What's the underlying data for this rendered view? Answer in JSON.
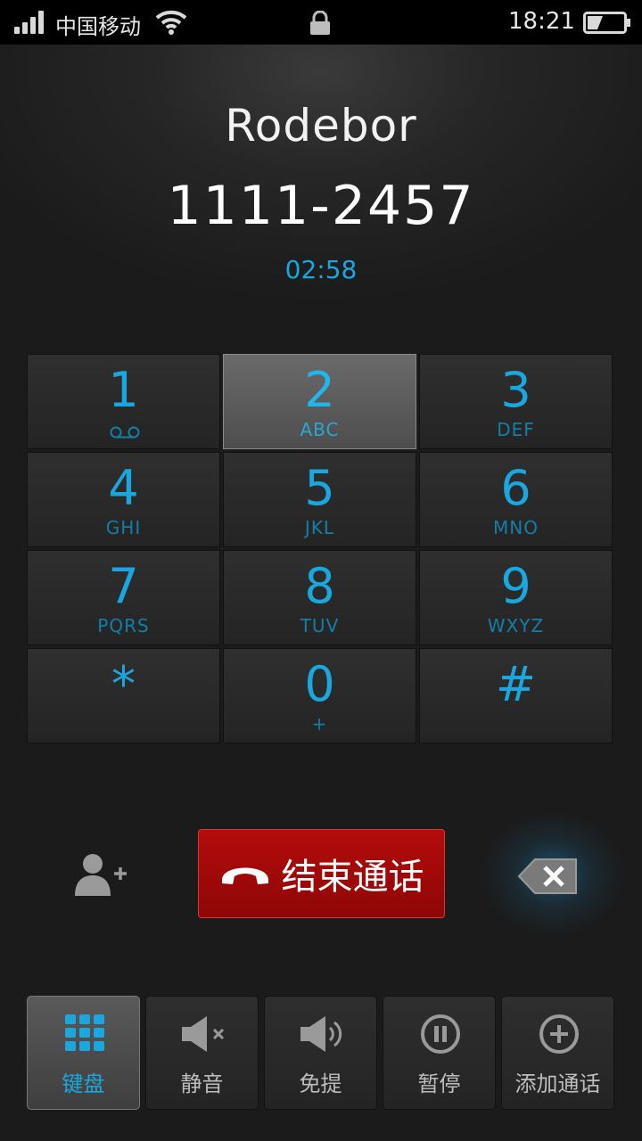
{
  "status_bar": {
    "carrier": "中国移动",
    "time": "18:21",
    "icons": [
      "signal-icon",
      "wifi-icon",
      "lock-icon",
      "battery-icon"
    ]
  },
  "call": {
    "name": "Rodebor",
    "number": "1111-2457",
    "duration": "02:58"
  },
  "dialpad": {
    "keys": [
      {
        "digit": "1",
        "letters": "",
        "icon": "voicemail-icon"
      },
      {
        "digit": "2",
        "letters": "ABC",
        "pressed": true
      },
      {
        "digit": "3",
        "letters": "DEF"
      },
      {
        "digit": "4",
        "letters": "GHI"
      },
      {
        "digit": "5",
        "letters": "JKL"
      },
      {
        "digit": "6",
        "letters": "MNO"
      },
      {
        "digit": "7",
        "letters": "PQRS"
      },
      {
        "digit": "8",
        "letters": "TUV"
      },
      {
        "digit": "9",
        "letters": "WXYZ"
      },
      {
        "digit": "*",
        "letters": ""
      },
      {
        "digit": "0",
        "letters": "+"
      },
      {
        "digit": "#",
        "letters": ""
      }
    ]
  },
  "controls": {
    "end_call_label": "结束通话",
    "add_contact_icon": "add-contact-icon",
    "backspace_icon": "backspace-icon"
  },
  "toolbar": {
    "items": [
      {
        "label": "键盘",
        "icon": "keypad-icon",
        "active": true
      },
      {
        "label": "静音",
        "icon": "mute-icon"
      },
      {
        "label": "免提",
        "icon": "speaker-icon"
      },
      {
        "label": "暂停",
        "icon": "pause-icon"
      },
      {
        "label": "添加通话",
        "icon": "add-call-icon"
      }
    ]
  },
  "colors": {
    "accent": "#1aa7e0",
    "end_call": "#a00808",
    "background": "#1b1b1b"
  }
}
